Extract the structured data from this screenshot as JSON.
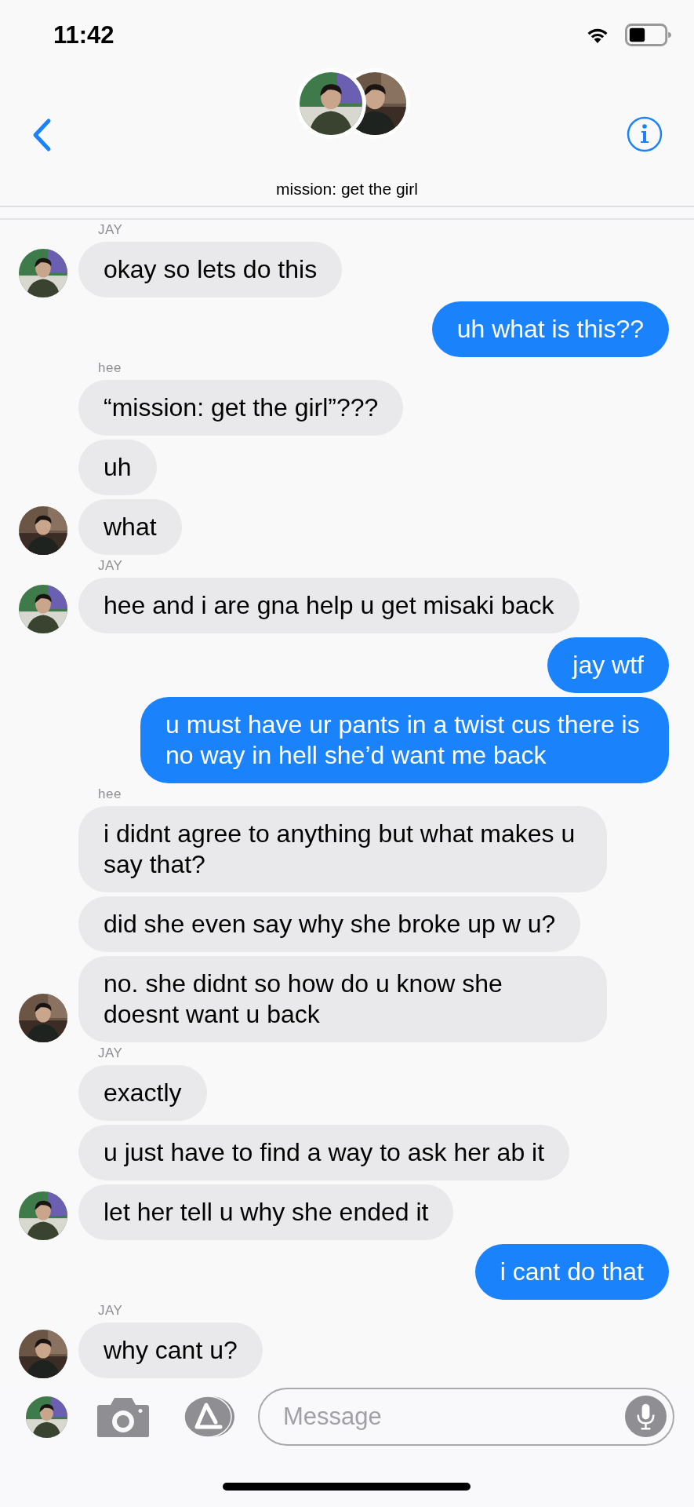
{
  "status_bar": {
    "time": "11:42"
  },
  "header": {
    "title": "mission: get the girl"
  },
  "messages": [
    {
      "kind": "sender",
      "name": "JAY"
    },
    {
      "kind": "in",
      "text": "okay so lets do this",
      "avatar": true
    },
    {
      "kind": "out",
      "text": "uh what is this??"
    },
    {
      "kind": "sender",
      "name": "hee"
    },
    {
      "kind": "in",
      "text": "“mission: get the girl”???",
      "avatar": false
    },
    {
      "kind": "in",
      "text": "uh",
      "avatar": false
    },
    {
      "kind": "in",
      "text": "what",
      "avatar": true
    },
    {
      "kind": "sender",
      "name": "JAY"
    },
    {
      "kind": "in",
      "text": "hee and i are gna help u get misaki back",
      "avatar": true
    },
    {
      "kind": "out",
      "text": "jay wtf"
    },
    {
      "kind": "out",
      "text": "u must have ur pants in a twist cus there is no way in hell she’d want me back"
    },
    {
      "kind": "sender",
      "name": "hee"
    },
    {
      "kind": "in",
      "text": "i didnt agree to anything but what makes u say that?",
      "avatar": false
    },
    {
      "kind": "in",
      "text": "did she even say why she broke up w u?",
      "avatar": false
    },
    {
      "kind": "in",
      "text": "no. she didnt so how do u know she doesnt want u back",
      "avatar": true
    },
    {
      "kind": "sender",
      "name": "JAY"
    },
    {
      "kind": "in",
      "text": "exactly",
      "avatar": false
    },
    {
      "kind": "in",
      "text": "u just have to find a way to ask her ab it",
      "avatar": false
    },
    {
      "kind": "in",
      "text": "let her tell u why she ended it",
      "avatar": true
    },
    {
      "kind": "out",
      "text": "i cant do that"
    },
    {
      "kind": "sender",
      "name": "JAY"
    },
    {
      "kind": "in",
      "text": "why cant u?",
      "avatar": true
    }
  ],
  "composer": {
    "placeholder": "Message"
  }
}
